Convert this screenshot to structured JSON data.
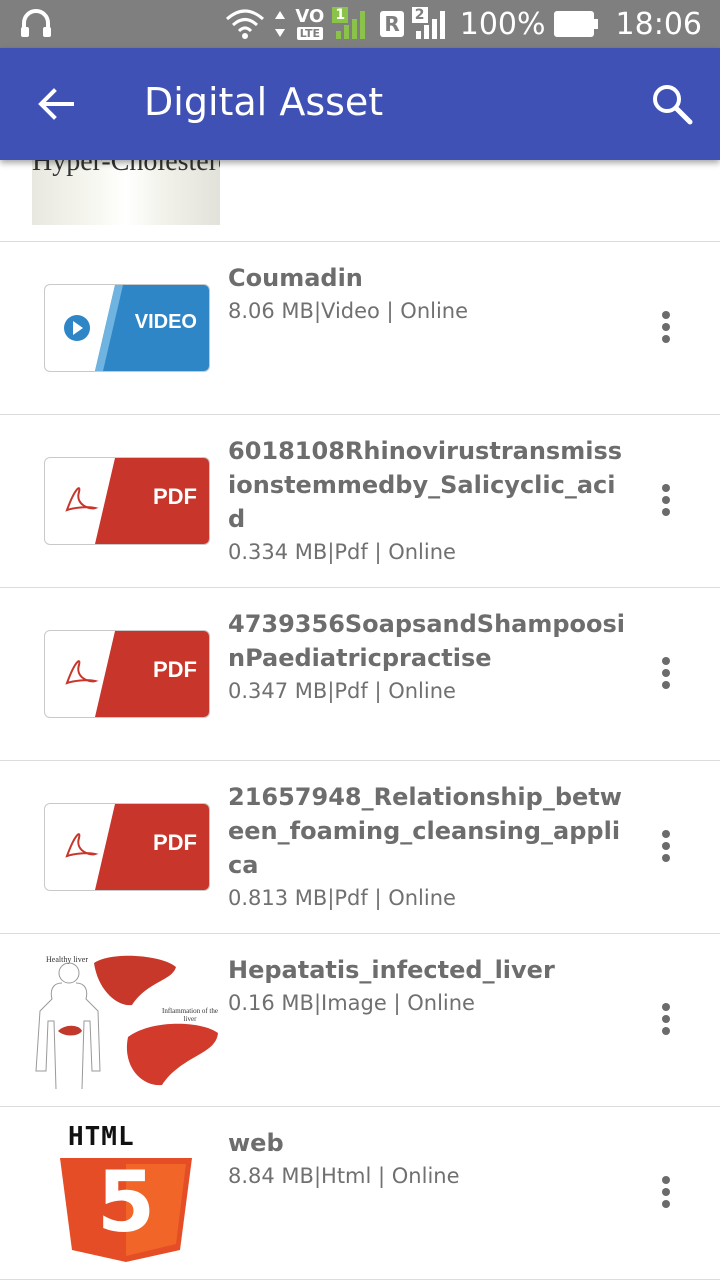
{
  "statusbar": {
    "volte_top": "VO",
    "volte_bottom": "LTE",
    "sim1": "1",
    "roaming": "R",
    "sim2": "2",
    "battery_percent": "100%",
    "time": "18:06"
  },
  "appbar": {
    "title": "Digital Asset",
    "back_icon": "arrow-back-icon",
    "search_icon": "search-icon"
  },
  "partial_row": {
    "thumb_caption": "Hyper-Cholesterol"
  },
  "items": [
    {
      "name": "Coumadin",
      "meta": "8.06 MB|Video | Online",
      "thumb": "video",
      "thumb_label": "VIDEO"
    },
    {
      "name": "6018108Rhinovirustransmissionstemmedby_Salicyclic_acid",
      "meta": "0.334 MB|Pdf | Online",
      "thumb": "pdf",
      "thumb_label": "PDF"
    },
    {
      "name": "4739356SoapsandShampoosinPaediatricpractise",
      "meta": "0.347 MB|Pdf | Online",
      "thumb": "pdf",
      "thumb_label": "PDF"
    },
    {
      "name": "21657948_Relationship_between_foaming_cleansing_applica",
      "meta": "0.813 MB|Pdf | Online",
      "thumb": "pdf",
      "thumb_label": "PDF"
    },
    {
      "name": "Hepatatis_infected_liver",
      "meta": "0.16 MB|Image | Online",
      "thumb": "image",
      "thumb_label_healthy": "Healthy liver",
      "thumb_label_inflamed": "Inflammation of the liver"
    },
    {
      "name": "web",
      "meta": "8.84 MB|Html | Online",
      "thumb": "html",
      "thumb_label": "HTML",
      "thumb_digit": "5"
    }
  ],
  "colors": {
    "appbar": "#3f51b5",
    "statusbar": "#7f7f7f",
    "video_blue": "#2f86c6",
    "pdf_red": "#c8352b",
    "html_orange": "#e44d26"
  }
}
